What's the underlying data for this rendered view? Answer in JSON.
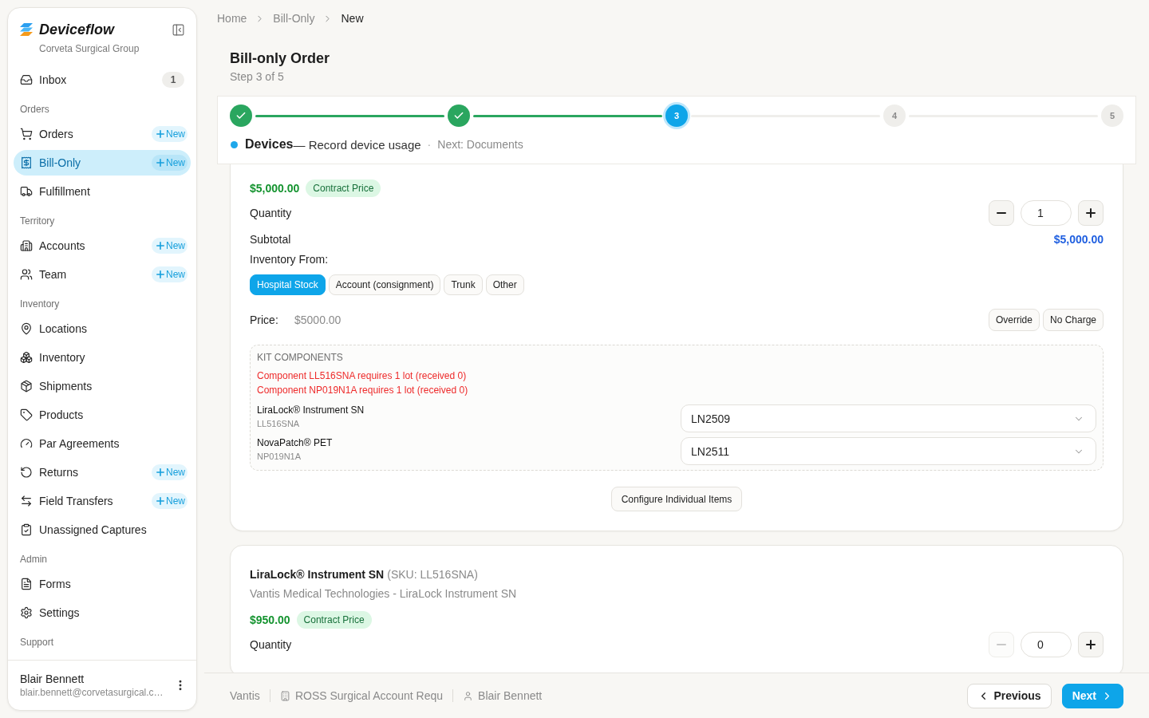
{
  "sidebar": {
    "brand": {
      "name": "Deviceflow",
      "org": "Corveta Surgical Group"
    },
    "sections": [
      {
        "items": [
          {
            "label": "Inbox",
            "count": "1",
            "selected": false
          }
        ]
      },
      {
        "title": "Orders",
        "items": [
          {
            "label": "Orders",
            "action": "New",
            "selected": false
          },
          {
            "label": "Bill-Only",
            "action": "New",
            "selected": true
          },
          {
            "label": "Fulfillment",
            "selected": false
          }
        ]
      },
      {
        "title": "Territory",
        "items": [
          {
            "label": "Accounts",
            "action": "New",
            "selected": false
          },
          {
            "label": "Team",
            "action": "New",
            "selected": false
          }
        ]
      },
      {
        "title": "Inventory",
        "items": [
          {
            "label": "Locations",
            "selected": false
          },
          {
            "label": "Inventory",
            "selected": false
          },
          {
            "label": "Shipments",
            "selected": false
          },
          {
            "label": "Products",
            "selected": false
          },
          {
            "label": "Par Agreements",
            "selected": false
          },
          {
            "label": "Returns",
            "action": "New",
            "selected": false
          },
          {
            "label": "Field Transfers",
            "action": "New",
            "selected": false
          },
          {
            "label": "Unassigned Captures",
            "selected": false
          }
        ]
      },
      {
        "title": "Admin",
        "items": [
          {
            "label": "Forms",
            "selected": false
          },
          {
            "label": "Settings",
            "selected": false
          }
        ]
      },
      {
        "title": "Support"
      }
    ],
    "user": {
      "name": "Blair Bennett",
      "email": "blair.bennett@corvetasurgical.c…"
    }
  },
  "breadcrumbs": [
    {
      "label": "Home",
      "current": false
    },
    {
      "label": "Bill-Only",
      "current": false
    },
    {
      "label": "New",
      "current": true
    }
  ],
  "header": {
    "title": "Bill-only Order",
    "subtitle": "Step 3 of 5"
  },
  "stepper": {
    "steps": [
      {
        "kind": "done"
      },
      {
        "kind": "done"
      },
      {
        "kind": "current",
        "number": "3"
      },
      {
        "kind": "upcoming",
        "number": "4"
      },
      {
        "kind": "upcoming",
        "number": "5"
      }
    ],
    "current_label": "Devices",
    "current_description": "— Record device usage",
    "separator": "·",
    "next": "Next: Documents"
  },
  "devices": [
    {
      "price": "$5,000.00",
      "price_badge": "Contract Price",
      "quantity_label": "Quantity",
      "quantity": "1",
      "decrease_disabled": false,
      "subtotal_label": "Subtotal",
      "subtotal": "$5,000.00",
      "inventory_label": "Inventory From:",
      "inventory_options": [
        {
          "label": "Hospital Stock",
          "selected": true
        },
        {
          "label": "Account (consignment)",
          "selected": false
        },
        {
          "label": "Trunk",
          "selected": false
        },
        {
          "label": "Other",
          "selected": false
        }
      ],
      "price_label": "Price:",
      "price_value": "$5000.00",
      "price_actions": [
        "Override",
        "No Charge"
      ],
      "kit": {
        "title": "KIT COMPONENTS",
        "errors": [
          "Component LL516SNA requires 1 lot (received 0)",
          "Component NP019N1A requires 1 lot (received 0)"
        ],
        "components": [
          {
            "name": "LiraLock® Instrument SN",
            "code": "LL516SNA",
            "lot": "LN2509"
          },
          {
            "name": "NovaPatch® PET",
            "code": "NP019N1A",
            "lot": "LN2511"
          }
        ]
      },
      "configure": "Configure Individual Items"
    },
    {
      "name": "LiraLock® Instrument SN",
      "sku": "(SKU: LL516SNA)",
      "vendor": "Vantis Medical Technologies - LiraLock Instrument SN",
      "price": "$950.00",
      "price_badge": "Contract Price",
      "quantity_label": "Quantity",
      "quantity": "0",
      "decrease_disabled": true
    }
  ],
  "footer": {
    "context": [
      {
        "kind": "text",
        "label": "Vantis"
      },
      {
        "kind": "account",
        "label": "ROSS Surgical Account Requ"
      },
      {
        "kind": "person",
        "label": "Blair Bennett"
      }
    ],
    "previous": "Previous",
    "next": "Next"
  }
}
